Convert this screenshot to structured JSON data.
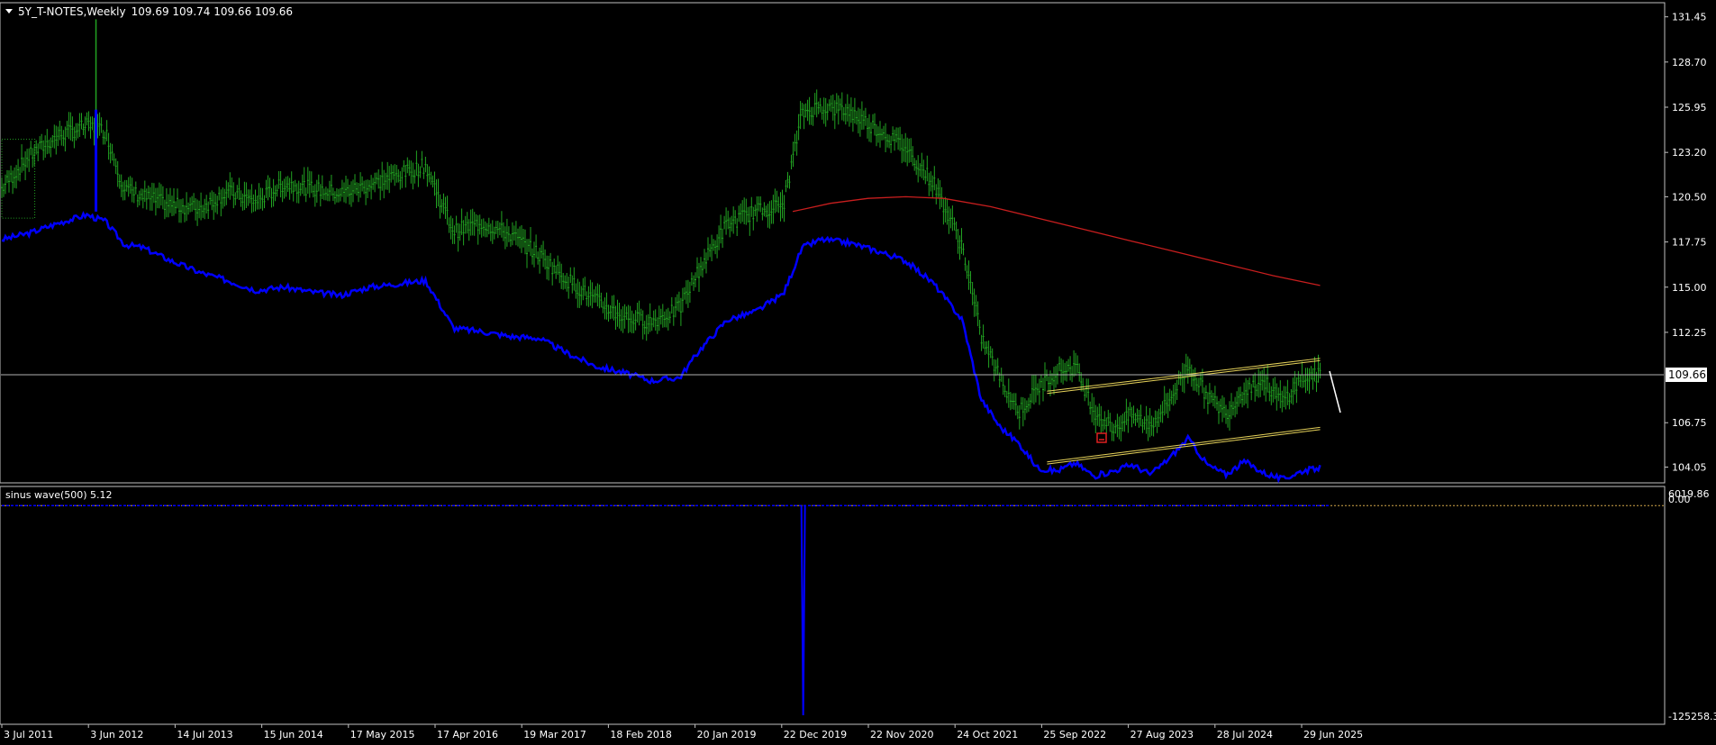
{
  "main_panel": {
    "symbol_label": "5Y_T-NOTES,Weekly",
    "ohlc_label": "109.69 109.74 109.66 109.66",
    "current_price": "109.66"
  },
  "sub_panel": {
    "indicator_label": "sinus wave(500) 5.12",
    "top_label": "6019.86",
    "zero_label": "0.00",
    "bottom_label": "-125258.3"
  },
  "colors": {
    "background": "#000000",
    "price_bars": "#22a322",
    "blue_line": "#0000ff",
    "ma_line": "#c81e1e",
    "channel": "#e6d25a",
    "axis": "#c0c0c0",
    "zero_line": "#d4a84a"
  },
  "chart_data": {
    "type": "line",
    "y_axis": {
      "ticks": [
        "131.45",
        "128.70",
        "125.95",
        "123.20",
        "120.50",
        "117.75",
        "115.00",
        "112.25",
        "109.66",
        "106.75",
        "104.05"
      ],
      "ylim": [
        103.2,
        132.2
      ]
    },
    "x_axis": {
      "ticks": [
        "3 Jul 2011",
        "3 Jun 2012",
        "14 Jul 2013",
        "15 Jun 2014",
        "17 May 2015",
        "17 Apr 2016",
        "19 Mar 2017",
        "18 Feb 2018",
        "20 Jan 2019",
        "22 Dec 2019",
        "22 Nov 2020",
        "24 Oct 2021",
        "25 Sep 2022",
        "27 Aug 2023",
        "28 Jul 2024",
        "29 Jun 2025"
      ],
      "xlim": [
        2011.5,
        2025.6
      ]
    },
    "series": [
      {
        "kind": "price",
        "x": [
          2011.5,
          2011.8,
          2012.1,
          2012.4,
          2012.6,
          2012.8,
          2013.0,
          2013.3,
          2013.6,
          2013.9,
          2014.2,
          2014.5,
          2014.8,
          2015.1,
          2015.4,
          2015.7,
          2016.0,
          2016.3,
          2016.6,
          2016.9,
          2017.2,
          2017.5,
          2017.8,
          2018.1,
          2018.4,
          2018.7,
          2018.9,
          2019.2,
          2019.5,
          2019.8,
          2020.0,
          2020.2,
          2020.5,
          2020.8,
          2021.1,
          2021.4,
          2021.7,
          2021.9,
          2022.1,
          2022.3,
          2022.5,
          2022.7,
          2022.9,
          2023.1,
          2023.3,
          2023.5,
          2023.7,
          2023.9,
          2024.1,
          2024.3,
          2024.5,
          2024.7,
          2024.9,
          2025.1,
          2025.3,
          2025.5
        ],
        "y": [
          121.0,
          123.0,
          124.2,
          124.8,
          124.5,
          121.0,
          120.5,
          120.0,
          119.8,
          120.8,
          120.2,
          121.3,
          121.0,
          120.7,
          121.2,
          121.8,
          122.4,
          118.4,
          118.9,
          118.2,
          117.0,
          115.5,
          114.2,
          113.2,
          112.9,
          113.7,
          116.0,
          118.8,
          119.6,
          120.0,
          125.6,
          126.0,
          125.7,
          124.6,
          123.5,
          121.3,
          117.5,
          112.0,
          109.5,
          107.4,
          108.8,
          109.9,
          110.2,
          107.5,
          106.4,
          107.2,
          106.6,
          108.1,
          110.2,
          108.4,
          107.3,
          108.8,
          109.3,
          108.0,
          109.4,
          109.66
        ]
      },
      {
        "kind": "blue",
        "x": [
          2011.5,
          2011.8,
          2012.1,
          2012.4,
          2012.6,
          2012.8,
          2013.0,
          2013.3,
          2013.6,
          2013.9,
          2014.2,
          2014.5,
          2014.8,
          2015.1,
          2015.4,
          2015.7,
          2016.0,
          2016.3,
          2016.6,
          2016.9,
          2017.2,
          2017.5,
          2017.8,
          2018.1,
          2018.4,
          2018.7,
          2018.9,
          2019.2,
          2019.5,
          2019.8,
          2020.0,
          2020.2,
          2020.5,
          2020.8,
          2021.1,
          2021.4,
          2021.7,
          2021.9,
          2022.1,
          2022.3,
          2022.5,
          2022.7,
          2022.9,
          2023.1,
          2023.3,
          2023.5,
          2023.7,
          2023.9,
          2024.1,
          2024.3,
          2024.5,
          2024.7,
          2024.9,
          2025.1,
          2025.3,
          2025.5
        ],
        "y": [
          117.9,
          118.3,
          118.9,
          119.4,
          119.0,
          117.6,
          117.4,
          116.6,
          115.9,
          115.4,
          114.8,
          115.0,
          114.7,
          114.5,
          115.0,
          115.2,
          115.4,
          112.5,
          112.3,
          112.0,
          111.9,
          111.0,
          110.2,
          109.8,
          109.3,
          109.5,
          111.1,
          113.0,
          113.5,
          114.6,
          117.4,
          117.9,
          117.7,
          117.2,
          116.6,
          115.2,
          113.0,
          108.2,
          106.5,
          105.5,
          104.0,
          103.8,
          104.3,
          103.5,
          103.8,
          104.2,
          103.6,
          104.6,
          105.8,
          104.2,
          103.6,
          104.4,
          103.7,
          103.3,
          103.8,
          104.0
        ]
      },
      {
        "kind": "ma",
        "x": [
          2019.9,
          2020.3,
          2020.7,
          2021.1,
          2021.5,
          2022.0,
          2022.5,
          2023.0,
          2023.5,
          2024.0,
          2024.5,
          2025.0,
          2025.5
        ],
        "y": [
          119.6,
          120.1,
          120.4,
          120.5,
          120.4,
          119.9,
          119.2,
          118.5,
          117.8,
          117.1,
          116.4,
          115.7,
          115.1
        ]
      }
    ],
    "channel": {
      "upper": {
        "x": [
          2022.6,
          2025.5
        ],
        "y": [
          108.6,
          110.6
        ]
      },
      "lower": {
        "x": [
          2022.6,
          2025.5
        ],
        "y": [
          104.3,
          106.4
        ]
      }
    },
    "sub_series": {
      "name": "sinus wave(500)",
      "ylim": [
        -125258.3,
        6019.86
      ],
      "baseline": 0,
      "spike": {
        "x": 2019.95,
        "y": -125258.3
      },
      "xlim": [
        2011.5,
        2025.5
      ]
    }
  }
}
